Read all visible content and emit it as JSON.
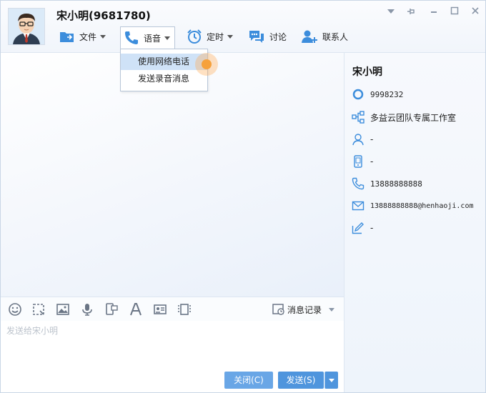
{
  "header": {
    "contact_title": "宋小明(9681780)",
    "window_controls": [
      "chevron-down-icon",
      "pin-icon",
      "maximize-icon",
      "close-icon"
    ]
  },
  "toolbar": {
    "file_label": "文件",
    "voice_label": "语音",
    "timer_label": "定时",
    "discuss_label": "讨论",
    "contacts_label": "联系人"
  },
  "voice_menu": {
    "items": [
      {
        "label": "使用网络电话",
        "selected": true
      },
      {
        "label": "发送录音消息",
        "selected": false
      }
    ]
  },
  "input": {
    "history_label": "消息记录",
    "placeholder": "发送给宋小明",
    "close_button": "关闭(C)",
    "send_button": "发送(S)"
  },
  "profile": {
    "name": "宋小明",
    "id": "9998232",
    "org": "多益云团队专属工作室",
    "position": "-",
    "mobile": "-",
    "phone": "13888888888",
    "email": "13888888888@henhaoji.com",
    "signature": "-"
  },
  "colors": {
    "accent": "#4a90d9",
    "icon_blue": "#3c8ddc",
    "selection": "#cfe2f7"
  }
}
